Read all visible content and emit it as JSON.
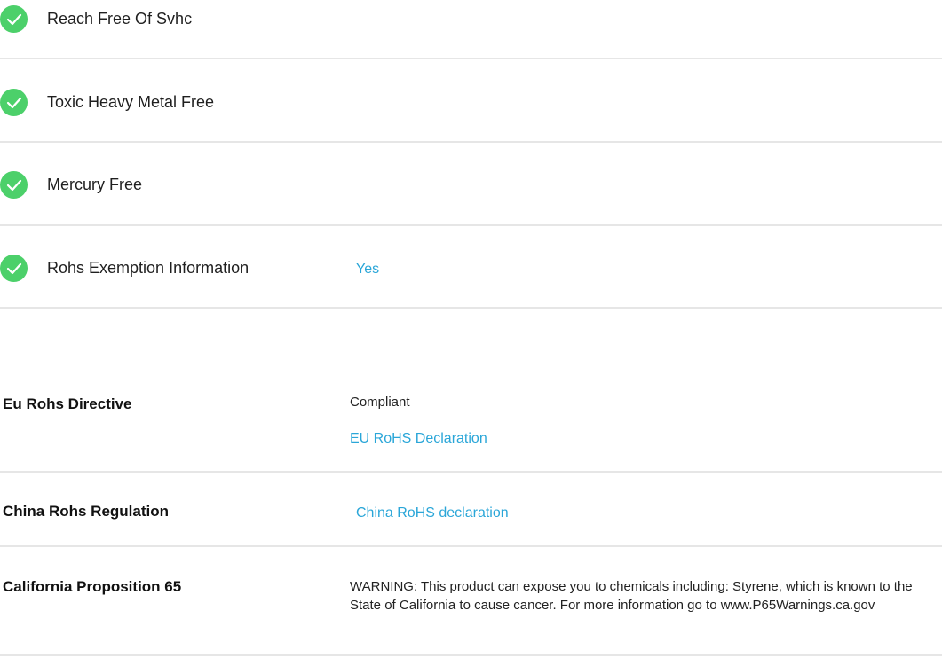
{
  "checklist": [
    {
      "label": "Reach Free Of Svhc",
      "icon": "check-circle-icon"
    },
    {
      "label": "Toxic Heavy Metal Free",
      "icon": "check-circle-icon"
    },
    {
      "label": "Mercury Free",
      "icon": "check-circle-icon"
    },
    {
      "label": "Rohs Exemption Information",
      "value": "Yes",
      "icon": "check-circle-icon"
    }
  ],
  "compliance": {
    "eu": {
      "label": "Eu Rohs Directive",
      "status": "Compliant",
      "link": "EU RoHS Declaration"
    },
    "china": {
      "label": "China Rohs Regulation",
      "link": "China RoHS declaration"
    },
    "california": {
      "label": "California Proposition 65",
      "text": "WARNING: This product can expose you to chemicals including: Styrene, which is known to the State of California to cause cancer. For more information go to www.P65Warnings.ca.gov"
    }
  },
  "colors": {
    "check": "#4cd06a",
    "link": "#2aa6d8",
    "divider": "#e6e6e6"
  }
}
